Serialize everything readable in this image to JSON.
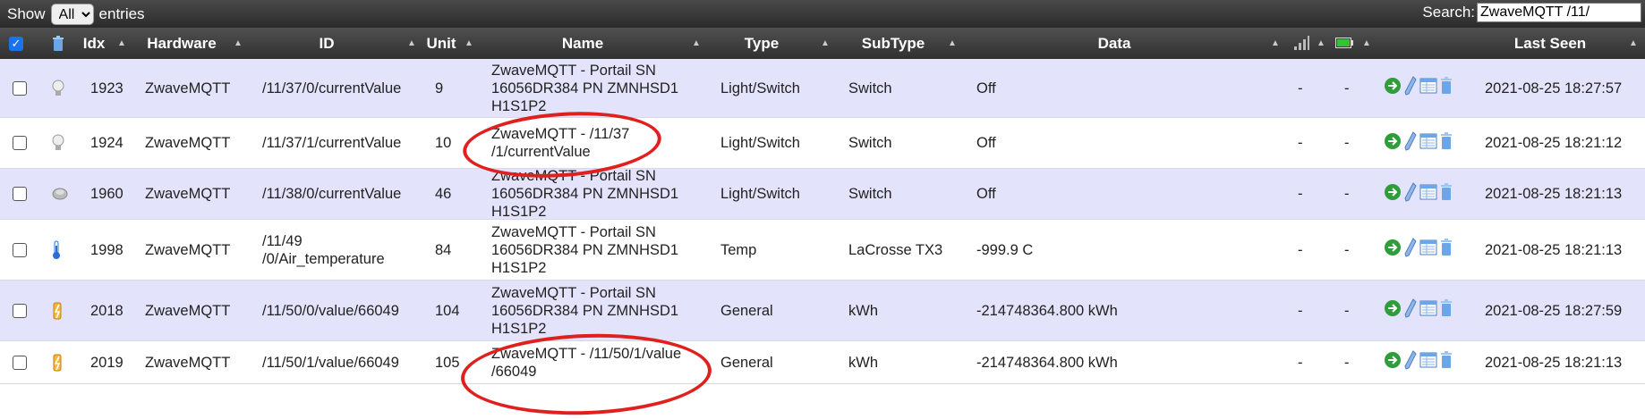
{
  "toolbar": {
    "show_label": "Show",
    "entries_option": "All",
    "entries_label": "entries",
    "search_label": "Search:",
    "search_value": "ZwaveMQTT /11/"
  },
  "columns": {
    "idx": "Idx",
    "hardware": "Hardware",
    "id": "ID",
    "unit": "Unit",
    "name": "Name",
    "type": "Type",
    "subtype": "SubType",
    "data": "Data",
    "last_seen": "Last Seen"
  },
  "rows": [
    {
      "idx": "1923",
      "hardware": "ZwaveMQTT",
      "id": "/11/37/0/currentValue",
      "unit": "9",
      "name": "ZwaveMQTT - Portail SN 16056DR384 PN ZMNHSD1 H1S1P2",
      "type": "Light/Switch",
      "subtype": "Switch",
      "data": "Off",
      "sig": "-",
      "bat": "-",
      "last_seen": "2021-08-25 18:27:57"
    },
    {
      "idx": "1924",
      "hardware": "ZwaveMQTT",
      "id": "/11/37/1/currentValue",
      "unit": "10",
      "name": "ZwaveMQTT - /11/37 /1/currentValue",
      "type": "Light/Switch",
      "subtype": "Switch",
      "data": "Off",
      "sig": "-",
      "bat": "-",
      "last_seen": "2021-08-25 18:21:12"
    },
    {
      "idx": "1960",
      "hardware": "ZwaveMQTT",
      "id": "/11/38/0/currentValue",
      "unit": "46",
      "name": "ZwaveMQTT - Portail SN 16056DR384 PN ZMNHSD1 H1S1P2",
      "type": "Light/Switch",
      "subtype": "Switch",
      "data": "Off",
      "sig": "-",
      "bat": "-",
      "last_seen": "2021-08-25 18:21:13"
    },
    {
      "idx": "1998",
      "hardware": "ZwaveMQTT",
      "id": "/11/49 /0/Air_temperature",
      "unit": "84",
      "name": "ZwaveMQTT - Portail SN 16056DR384 PN ZMNHSD1 H1S1P2",
      "type": "Temp",
      "subtype": "LaCrosse TX3",
      "data": "-999.9 C",
      "sig": "-",
      "bat": "-",
      "last_seen": "2021-08-25 18:21:13"
    },
    {
      "idx": "2018",
      "hardware": "ZwaveMQTT",
      "id": "/11/50/0/value/66049",
      "unit": "104",
      "name": "ZwaveMQTT - Portail SN 16056DR384 PN ZMNHSD1 H1S1P2",
      "type": "General",
      "subtype": "kWh",
      "data": "-214748364.800 kWh",
      "sig": "-",
      "bat": "-",
      "last_seen": "2021-08-25 18:27:59"
    },
    {
      "idx": "2019",
      "hardware": "ZwaveMQTT",
      "id": "/11/50/1/value/66049",
      "unit": "105",
      "name": "ZwaveMQTT - /11/50/1/value /66049",
      "type": "General",
      "subtype": "kWh",
      "data": "-214748364.800 kWh",
      "sig": "-",
      "bat": "-",
      "last_seen": "2021-08-25 18:21:13"
    }
  ],
  "row_icons": [
    "bulb-icon",
    "bulb-icon",
    "blind-icon",
    "thermometer-icon",
    "meter-icon",
    "meter-icon"
  ],
  "colors": {
    "row_odd": "#e3e3fb",
    "row_even": "#ffffff",
    "annotation": "#e0201e",
    "checkbox_accent": "#1a73e8"
  }
}
